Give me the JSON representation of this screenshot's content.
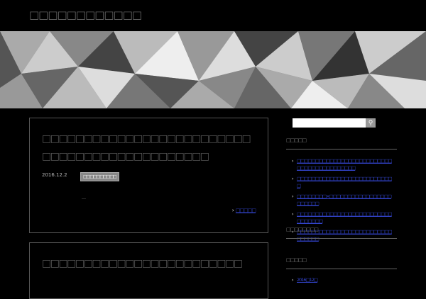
{
  "site": {
    "title": "□□□□□□□□□□□□"
  },
  "posts": [
    {
      "title": "□□□□□□□□□□□□□□□□□□□□□□□□□□□□□□□□□□□□□□□□□□□□□",
      "date": "2016.12.2",
      "category": "□□□□□□□□□□",
      "excerpt": "…",
      "more": "□□□□□"
    },
    {
      "title": "□□□□□□□□□□□□□□□□□□□□□□□□"
    }
  ],
  "sidebar": {
    "search_placeholder": "",
    "recent_title": "□□□□□",
    "recent": [
      "□□□□□□□□□□□□□□□□□□□□□□□□□□□□□□□□□□□□□□□□□□",
      "□□□□□□□□□□□□□□□□□□□□□□□□□□□",
      "□□□□□□□□×□□□□□□□□□□□□□□□□□□□□□□□",
      "□□□□□□□□□□□□□□□□□□□□□□□□□□□□□□□□□",
      "□□□□□□□□□□□□□□□□□□□□□□□□□□□□□□□□"
    ],
    "comments_title": "□□□□□□□□",
    "archive_title": "□□□□□",
    "archive": [
      "2016□12□"
    ]
  }
}
